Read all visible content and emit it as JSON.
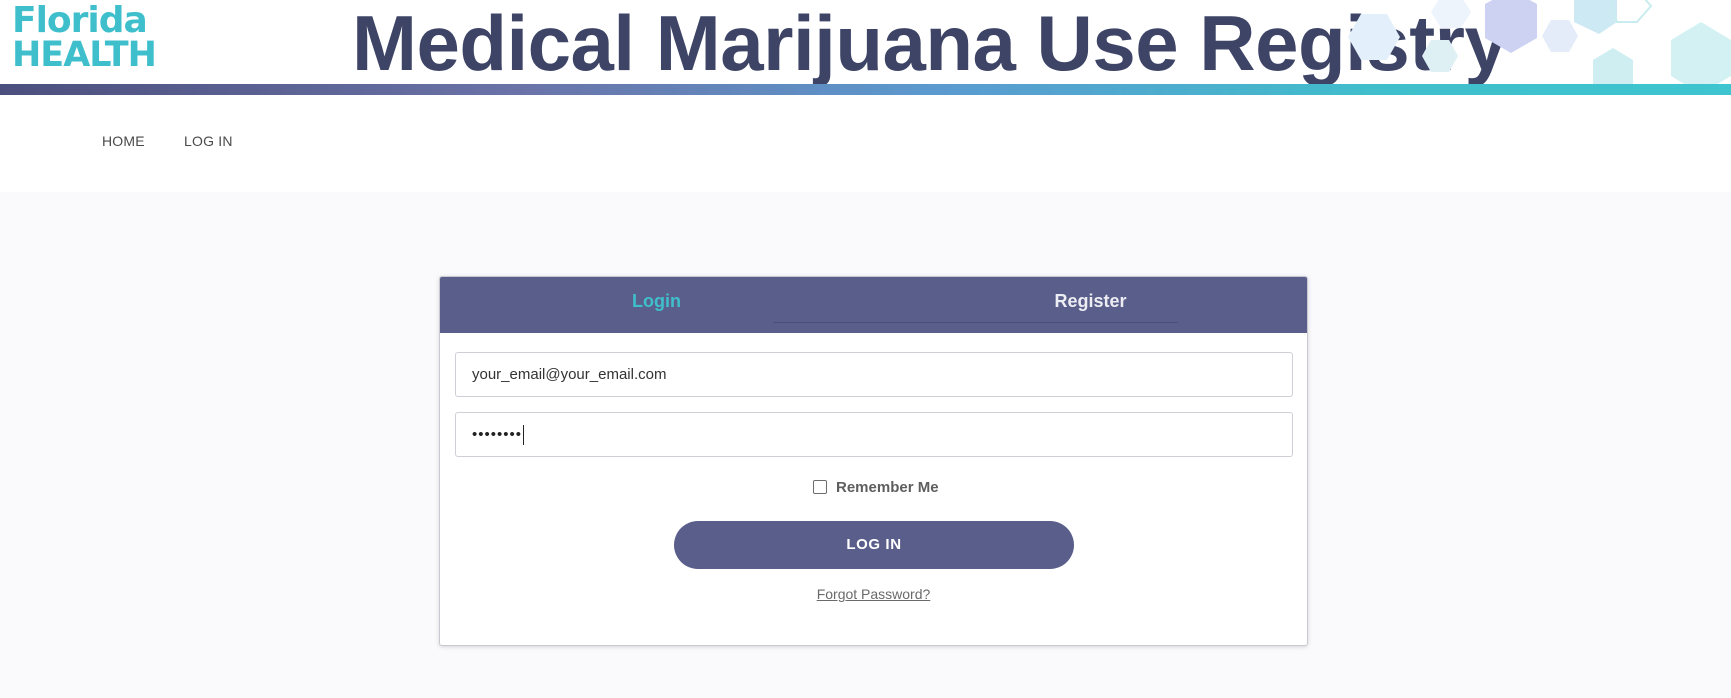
{
  "header": {
    "logo_line1": "Florida",
    "logo_line2": "HEALTH",
    "title": "Medical Marijuana Use Registry",
    "colors": {
      "logo": "#3fbfcb",
      "title": "#3d4466",
      "stripe_start": "#4b4f7d",
      "stripe_end": "#3ec5cf"
    }
  },
  "nav": {
    "items": [
      {
        "label": "HOME"
      },
      {
        "label": "LOG IN"
      }
    ]
  },
  "login_card": {
    "tabs": [
      {
        "label": "Login",
        "active": true
      },
      {
        "label": "Register",
        "active": false
      }
    ],
    "email_value": "your_email@your_email.com",
    "password_masked": "••••••••",
    "remember_label": "Remember Me",
    "remember_checked": false,
    "submit_label": "LOG IN",
    "forgot_label": "Forgot Password?",
    "colors": {
      "tab_bar": "#5a5e8a",
      "active_tab": "#3fbfcb",
      "button": "#5a5e8a"
    }
  }
}
